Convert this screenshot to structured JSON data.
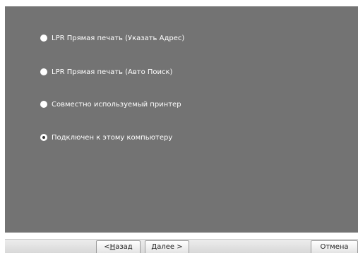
{
  "options": [
    {
      "label": "LPR Прямая печать (Указать Адрес)",
      "selected": false
    },
    {
      "label": "LPR Прямая печать (Авто Поиск)",
      "selected": false
    },
    {
      "label": "Совместно используемый принтер",
      "selected": false
    },
    {
      "label": "Подключен к этому компьютеру",
      "selected": true
    }
  ],
  "buttons": {
    "back_prefix": "< ",
    "back_accel": "Н",
    "back_rest": "азад",
    "next_accel": "Д",
    "next_rest": "алее >",
    "cancel": "Отмена"
  },
  "colors": {
    "panel": "#737373",
    "text": "#ffffff"
  }
}
